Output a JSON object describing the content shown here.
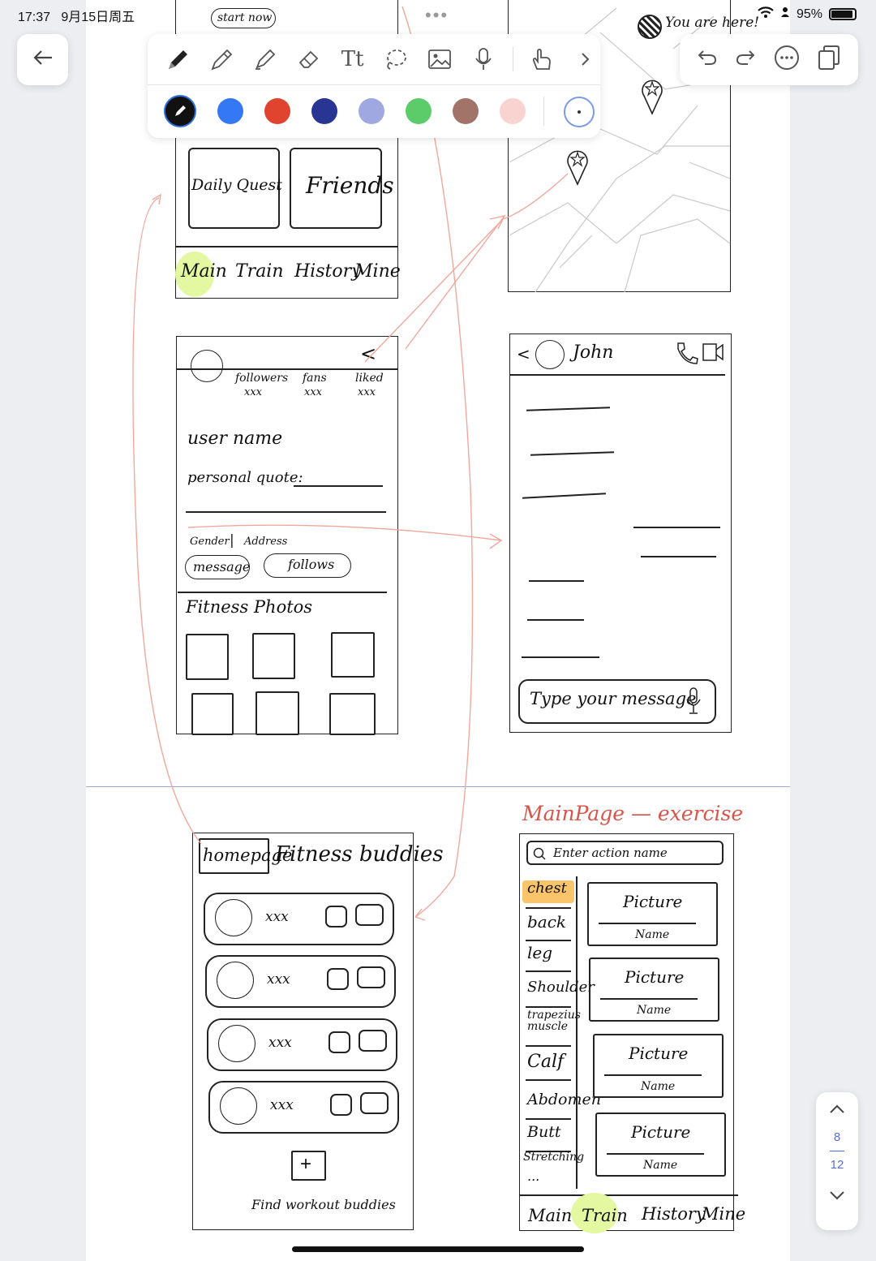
{
  "status_bar": {
    "time": "17:37",
    "date": "9月15日周五",
    "battery": "95%",
    "icons": [
      "wifi-icon",
      "person-icon",
      "battery-icon"
    ]
  },
  "toolbar": {
    "tools": [
      "pen-icon",
      "pencil-icon",
      "highlighter-icon",
      "eraser-icon",
      "text-tool-icon",
      "lasso-icon",
      "image-icon",
      "microphone-icon",
      "finger-icon",
      "chevron-right-icon"
    ],
    "text_tool_label": "Tt",
    "colors": [
      "#111111",
      "#3478f6",
      "#e0442f",
      "#283593",
      "#9fa8e0",
      "#5ccb6a",
      "#a27469",
      "#f8d3cf"
    ],
    "selected_color": "#111111"
  },
  "right_tools": [
    "undo-icon",
    "redo-icon",
    "more-icon",
    "pages-icon"
  ],
  "pager": {
    "current": "8",
    "total": "12"
  },
  "sketch_home": {
    "start_button": "start now",
    "cards": [
      "Daily Quest",
      "Friends"
    ],
    "nav": [
      "Main",
      "Train",
      "History",
      "Mine"
    ],
    "active_nav": "Main"
  },
  "sketch_map": {
    "you_are_here": "You are here!"
  },
  "sketch_profile": {
    "stats": [
      {
        "label": "followers",
        "value": "xxx"
      },
      {
        "label": "fans",
        "value": "xxx"
      },
      {
        "label": "liked",
        "value": "xxx"
      }
    ],
    "back": "<",
    "username": "user name",
    "quote": "personal quote:",
    "gender": "Gender",
    "separator": "|",
    "address": "Address",
    "buttons": [
      "message",
      "follows"
    ],
    "photos_title": "Fitness Photos"
  },
  "sketch_chat": {
    "contact": "John",
    "back": "<",
    "placeholder": "Type your message"
  },
  "sketch_buddies": {
    "tabs": [
      "homepage",
      "Fitness buddies"
    ],
    "rows": [
      "xxx",
      "xxx",
      "xxx",
      "xxx"
    ],
    "add": "+",
    "footer": "Find workout buddies"
  },
  "sketch_train": {
    "section_title": "MainPage — exercise",
    "search": "Enter action name",
    "categories": [
      "chest",
      "back",
      "leg",
      "Shoulder",
      "trapezius muscle",
      "Calf",
      "Abdomen",
      "Butt",
      "Stretching",
      "..."
    ],
    "active_category": "chest",
    "cards": [
      {
        "picture": "Picture",
        "name": "Name"
      },
      {
        "picture": "Picture",
        "name": "Name"
      },
      {
        "picture": "Picture",
        "name": "Name"
      },
      {
        "picture": "Picture",
        "name": "Name"
      }
    ],
    "nav": [
      "Main",
      "Train",
      "History",
      "Mine"
    ],
    "active_nav": "Train"
  }
}
